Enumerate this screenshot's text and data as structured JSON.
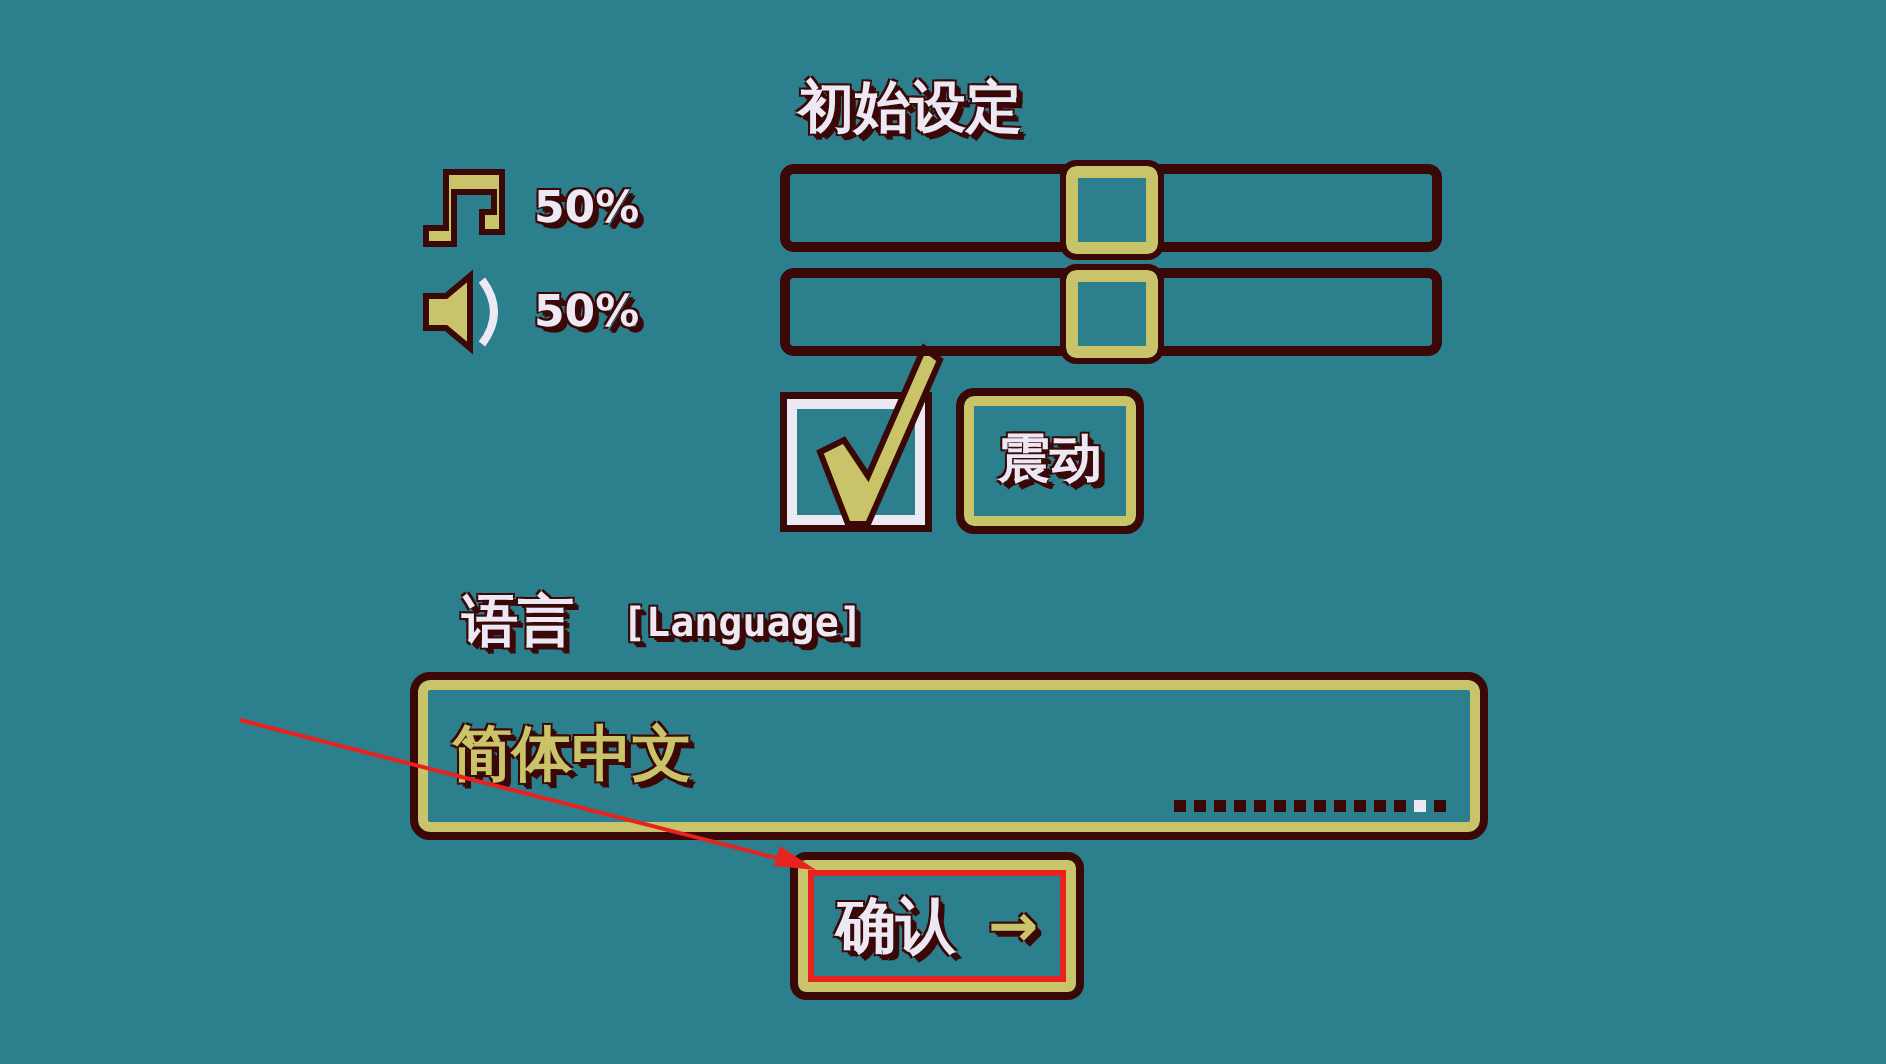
{
  "title": "初始设定",
  "sliders": [
    {
      "kind": "music",
      "reading": "50%",
      "level": 0.5
    },
    {
      "kind": "sound",
      "reading": "50%",
      "level": 0.5
    }
  ],
  "vibration": {
    "label": "震动",
    "checked": true
  },
  "language": {
    "label": "语言",
    "sublabel": "[Language]",
    "value": "简体中文",
    "pages": [
      {
        "selected": false
      },
      {
        "selected": false
      },
      {
        "selected": false
      },
      {
        "selected": false
      },
      {
        "selected": false
      },
      {
        "selected": false
      },
      {
        "selected": false
      },
      {
        "selected": false
      },
      {
        "selected": false
      },
      {
        "selected": false
      },
      {
        "selected": false
      },
      {
        "selected": false
      },
      {
        "selected": true
      },
      {
        "selected": false
      }
    ]
  },
  "confirm": {
    "label": "确认",
    "arrow": "→"
  },
  "callout": {
    "arrow": true,
    "highlight": true
  }
}
